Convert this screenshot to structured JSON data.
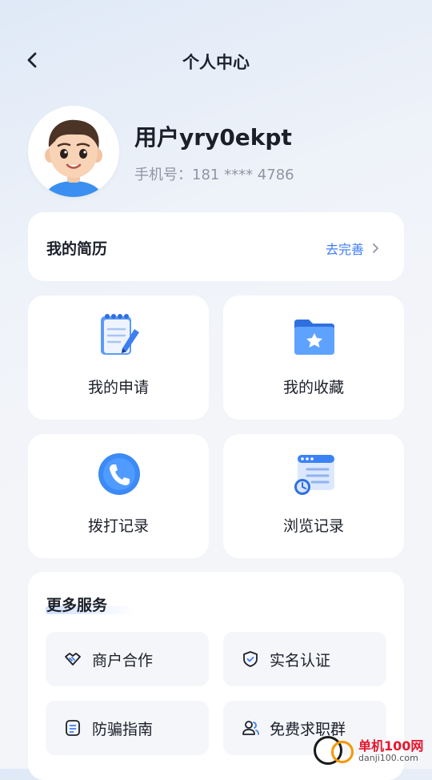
{
  "header": {
    "title": "个人中心"
  },
  "profile": {
    "username": "用户yry0ekpt",
    "phone": "手机号：181 **** 4786"
  },
  "resume": {
    "title": "我的简历",
    "action": "去完善"
  },
  "tiles": [
    {
      "label": "我的申请",
      "icon": "notepad-icon"
    },
    {
      "label": "我的收藏",
      "icon": "star-folder-icon"
    },
    {
      "label": "拨打记录",
      "icon": "phone-call-icon"
    },
    {
      "label": "浏览记录",
      "icon": "browser-history-icon"
    }
  ],
  "services": {
    "title": "更多服务",
    "items": [
      {
        "label": "商户合作",
        "icon": "handshake-icon"
      },
      {
        "label": "实名认证",
        "icon": "shield-check-icon"
      },
      {
        "label": "防骗指南",
        "icon": "document-icon"
      },
      {
        "label": "免费求职群",
        "icon": "group-icon"
      }
    ]
  },
  "watermark": {
    "name": "单机100网",
    "url": "danji100.com"
  },
  "colors": {
    "accent": "#3f7df5",
    "background": "#f4f5f9",
    "card": "#ffffff"
  }
}
